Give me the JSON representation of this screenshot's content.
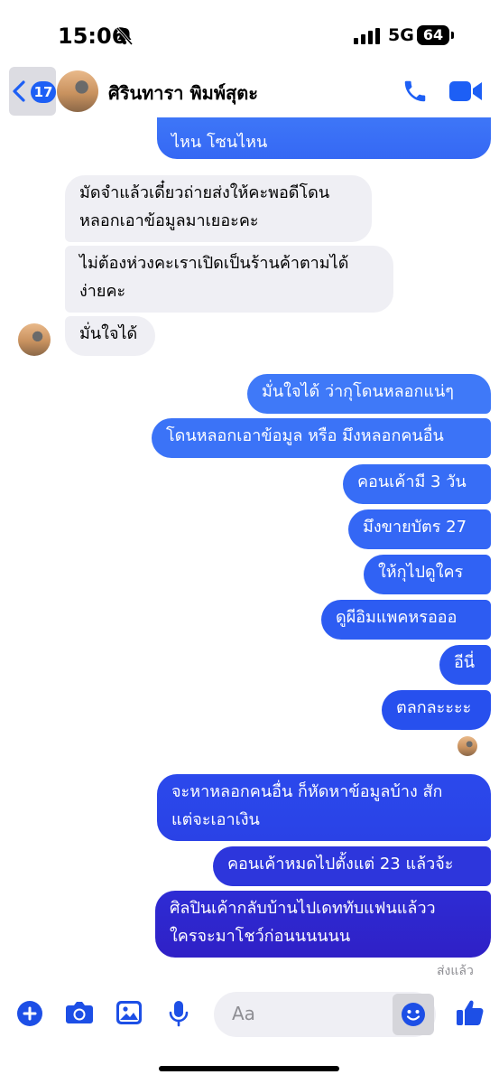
{
  "status_bar": {
    "time": "15:06",
    "network": "5G",
    "battery": "64"
  },
  "header": {
    "back_count": "17",
    "contact_name": "ศิรินทารา พิมพ์สุตะ"
  },
  "messages": [
    {
      "id": "m0",
      "dir": "out",
      "lines": [
        "ไหน โซนไหน"
      ]
    },
    {
      "id": "m1",
      "dir": "in",
      "lines": [
        "มัดจำแล้วเดี๋ยวถ่ายส่งให้คะพอดีโดน",
        "หลอกเอาข้อมูลมาเยอะคะ"
      ]
    },
    {
      "id": "m2",
      "dir": "in",
      "lines": [
        "ไม่ต้องห่วงคะเราเปิดเป็นร้านค้าตามได้",
        "ง่ายคะ"
      ]
    },
    {
      "id": "m3",
      "dir": "in",
      "lines": [
        "มั่นใจได้"
      ]
    },
    {
      "id": "m4",
      "dir": "out",
      "lines": [
        "มั่นใจได้ ว่ากุโดนหลอกแน่ๆ"
      ]
    },
    {
      "id": "m5",
      "dir": "out",
      "lines": [
        "โดนหลอกเอาข้อมูล หรือ มึงหลอกคนอื่น"
      ]
    },
    {
      "id": "m6",
      "dir": "out",
      "lines": [
        "คอนเค้ามี 3 วัน"
      ]
    },
    {
      "id": "m7",
      "dir": "out",
      "lines": [
        "มึงขายบัตร 27"
      ]
    },
    {
      "id": "m8",
      "dir": "out",
      "lines": [
        "ให้กุไปดูใคร"
      ]
    },
    {
      "id": "m9",
      "dir": "out",
      "lines": [
        "ดูผีอิมแพคหรอออ"
      ]
    },
    {
      "id": "m10",
      "dir": "out",
      "lines": [
        "อีนี่"
      ]
    },
    {
      "id": "m11",
      "dir": "out",
      "lines": [
        "ตลกละะะะ"
      ]
    },
    {
      "id": "m12",
      "dir": "out",
      "lines": [
        "จะหาหลอกคนอื่น ก็หัดหาข้อมูลบ้าง สัก",
        "แต่จะเอาเงิน"
      ]
    },
    {
      "id": "m13",
      "dir": "out",
      "lines": [
        "คอนเค้าหมดไปตั้งแต่ 23 แล้วจ้ะ"
      ]
    },
    {
      "id": "m14",
      "dir": "out",
      "lines": [
        "ศิลปินเค้ากลับบ้านไปเดททับแฟนแล้วว",
        "ใครจะมาโชว์ก่อนนนนนน"
      ]
    }
  ],
  "sent_status": "ส่งแล้ว",
  "composer": {
    "placeholder": "Aa"
  },
  "colors": {
    "accent": "#1d5ff5",
    "bubble_out_top": "#3f78f8",
    "bubble_out_bottom": "#2f1fc8",
    "bubble_in": "#efeff4"
  }
}
